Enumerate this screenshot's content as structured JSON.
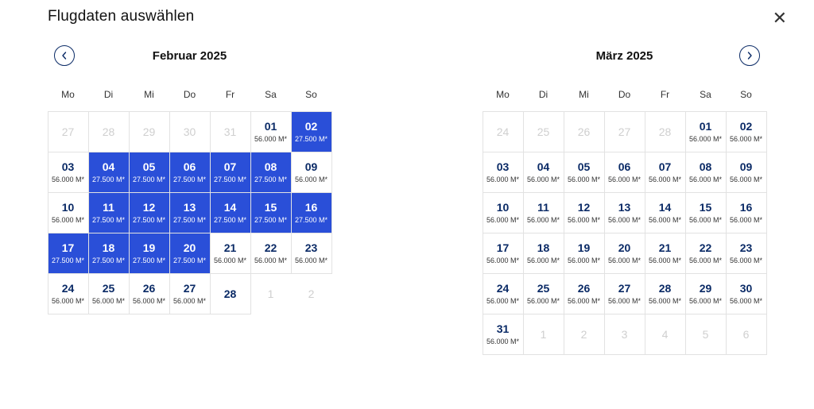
{
  "title": "Flugdaten auswählen",
  "weekdays": [
    "Mo",
    "Di",
    "Mi",
    "Do",
    "Fr",
    "Sa",
    "So"
  ],
  "months": [
    {
      "label": "Februar 2025",
      "nav": "prev",
      "days": [
        {
          "n": "27",
          "muted": true
        },
        {
          "n": "28",
          "muted": true
        },
        {
          "n": "29",
          "muted": true
        },
        {
          "n": "30",
          "muted": true
        },
        {
          "n": "31",
          "muted": true
        },
        {
          "n": "01",
          "p": "56.000 M*"
        },
        {
          "n": "02",
          "p": "27.500 M*",
          "hl": true
        },
        {
          "n": "03",
          "p": "56.000 M*"
        },
        {
          "n": "04",
          "p": "27.500 M*",
          "hl": true
        },
        {
          "n": "05",
          "p": "27.500 M*",
          "hl": true
        },
        {
          "n": "06",
          "p": "27.500 M*",
          "hl": true
        },
        {
          "n": "07",
          "p": "27.500 M*",
          "hl": true
        },
        {
          "n": "08",
          "p": "27.500 M*",
          "hl": true
        },
        {
          "n": "09",
          "p": "56.000 M*"
        },
        {
          "n": "10",
          "p": "56.000 M*"
        },
        {
          "n": "11",
          "p": "27.500 M*",
          "hl": true
        },
        {
          "n": "12",
          "p": "27.500 M*",
          "hl": true
        },
        {
          "n": "13",
          "p": "27.500 M*",
          "hl": true
        },
        {
          "n": "14",
          "p": "27.500 M*",
          "hl": true
        },
        {
          "n": "15",
          "p": "27.500 M*",
          "hl": true
        },
        {
          "n": "16",
          "p": "27.500 M*",
          "hl": true
        },
        {
          "n": "17",
          "p": "27.500 M*",
          "hl": true
        },
        {
          "n": "18",
          "p": "27.500 M*",
          "hl": true
        },
        {
          "n": "19",
          "p": "27.500 M*",
          "hl": true
        },
        {
          "n": "20",
          "p": "27.500 M*",
          "hl": true
        },
        {
          "n": "21",
          "p": "56.000 M*"
        },
        {
          "n": "22",
          "p": "56.000 M*"
        },
        {
          "n": "23",
          "p": "56.000 M*"
        },
        {
          "n": "24",
          "p": "56.000 M*"
        },
        {
          "n": "25",
          "p": "56.000 M*"
        },
        {
          "n": "26",
          "p": "56.000 M*"
        },
        {
          "n": "27",
          "p": "56.000 M*"
        },
        {
          "n": "28"
        },
        {
          "n": "1",
          "muted": true,
          "blank": true
        },
        {
          "n": "2",
          "muted": true,
          "blank": true
        }
      ]
    },
    {
      "label": "März 2025",
      "nav": "next",
      "days": [
        {
          "n": "24",
          "muted": true
        },
        {
          "n": "25",
          "muted": true
        },
        {
          "n": "26",
          "muted": true
        },
        {
          "n": "27",
          "muted": true
        },
        {
          "n": "28",
          "muted": true
        },
        {
          "n": "01",
          "p": "56.000 M*"
        },
        {
          "n": "02",
          "p": "56.000 M*"
        },
        {
          "n": "03",
          "p": "56.000 M*"
        },
        {
          "n": "04",
          "p": "56.000 M*"
        },
        {
          "n": "05",
          "p": "56.000 M*"
        },
        {
          "n": "06",
          "p": "56.000 M*"
        },
        {
          "n": "07",
          "p": "56.000 M*"
        },
        {
          "n": "08",
          "p": "56.000 M*"
        },
        {
          "n": "09",
          "p": "56.000 M*"
        },
        {
          "n": "10",
          "p": "56.000 M*"
        },
        {
          "n": "11",
          "p": "56.000 M*"
        },
        {
          "n": "12",
          "p": "56.000 M*"
        },
        {
          "n": "13",
          "p": "56.000 M*"
        },
        {
          "n": "14",
          "p": "56.000 M*"
        },
        {
          "n": "15",
          "p": "56.000 M*"
        },
        {
          "n": "16",
          "p": "56.000 M*"
        },
        {
          "n": "17",
          "p": "56.000 M*"
        },
        {
          "n": "18",
          "p": "56.000 M*"
        },
        {
          "n": "19",
          "p": "56.000 M*"
        },
        {
          "n": "20",
          "p": "56.000 M*"
        },
        {
          "n": "21",
          "p": "56.000 M*"
        },
        {
          "n": "22",
          "p": "56.000 M*"
        },
        {
          "n": "23",
          "p": "56.000 M*"
        },
        {
          "n": "24",
          "p": "56.000 M*"
        },
        {
          "n": "25",
          "p": "56.000 M*"
        },
        {
          "n": "26",
          "p": "56.000 M*"
        },
        {
          "n": "27",
          "p": "56.000 M*"
        },
        {
          "n": "28",
          "p": "56.000 M*"
        },
        {
          "n": "29",
          "p": "56.000 M*"
        },
        {
          "n": "30",
          "p": "56.000 M*"
        },
        {
          "n": "31",
          "p": "56.000 M*"
        },
        {
          "n": "1",
          "muted": true
        },
        {
          "n": "2",
          "muted": true
        },
        {
          "n": "3",
          "muted": true
        },
        {
          "n": "4",
          "muted": true
        },
        {
          "n": "5",
          "muted": true
        },
        {
          "n": "6",
          "muted": true
        }
      ]
    }
  ]
}
